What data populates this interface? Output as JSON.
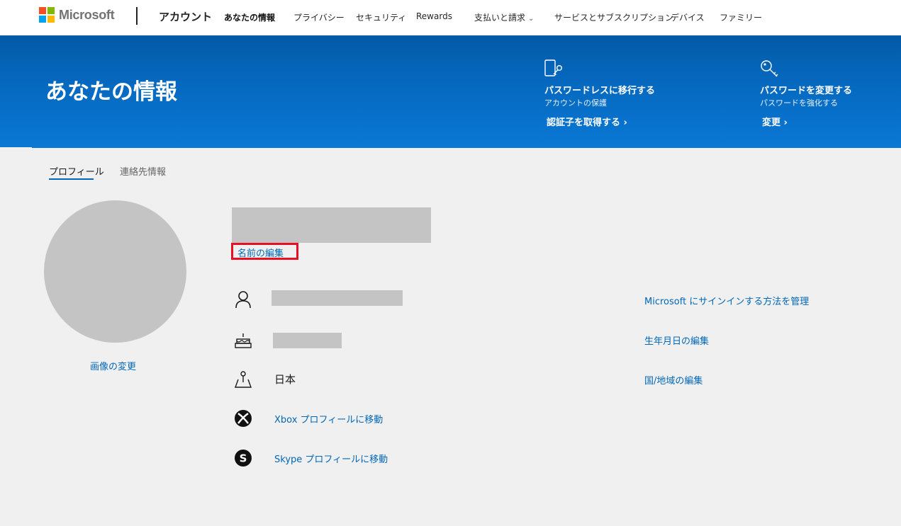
{
  "topnav": {
    "brand": "Microsoft",
    "title": "アカウント",
    "items": [
      {
        "label": "あなたの情報"
      },
      {
        "label": "プライバシー"
      },
      {
        "label": "セキュリティ"
      },
      {
        "label": "Rewards"
      },
      {
        "label": "支払いと請求"
      },
      {
        "label": "サービスとサブスクリプション"
      },
      {
        "label": "デバイス"
      },
      {
        "label": "ファミリー"
      }
    ]
  },
  "hero": {
    "title": "あなたの情報",
    "cards": [
      {
        "heading": "パスワードレスに移行する",
        "sub": "アカウントの保護",
        "link": "認証子を取得する",
        "icon": "phone-key-icon"
      },
      {
        "heading": "パスワードを変更する",
        "sub": "パスワードを強化する",
        "link": "変更",
        "icon": "key-icon"
      }
    ]
  },
  "tabs": [
    {
      "label": "プロフィール"
    },
    {
      "label": "連絡先情報"
    }
  ],
  "profile": {
    "change_photo": "画像の変更",
    "edit_name": "名前の編集",
    "country": "日本",
    "xbox_link": "Xbox プロフィールに移動",
    "skype_link": "Skype プロフィールに移動",
    "manage_signin": "Microsoft にサインインする方法を管理",
    "edit_birthday": "生年月日の編集",
    "edit_country": "国/地域の編集"
  },
  "colors": {
    "accent": "#0067b8",
    "hero": "#0568be",
    "highlight": "#e81123"
  }
}
